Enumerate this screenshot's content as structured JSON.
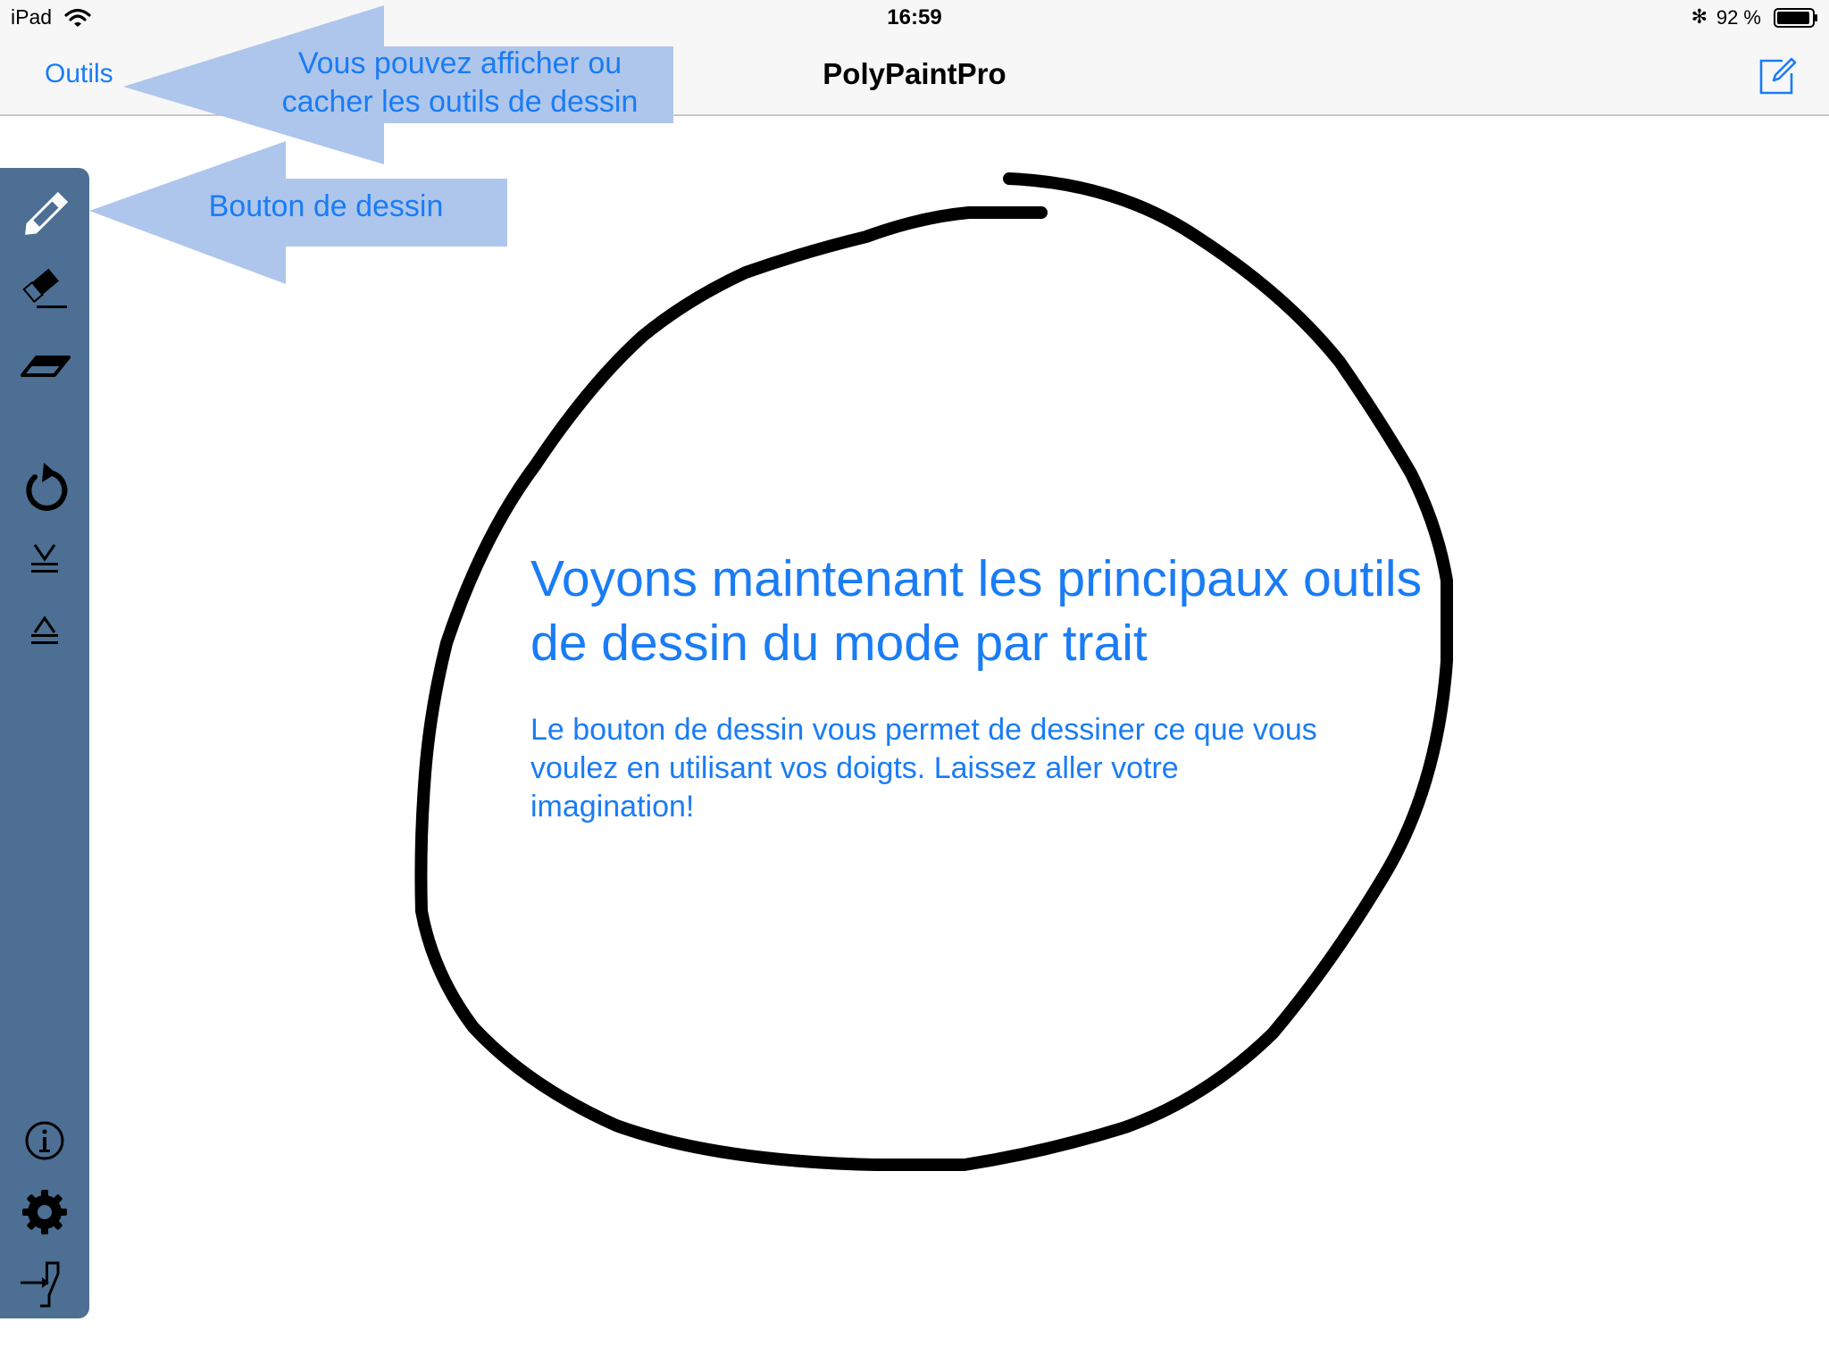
{
  "status_bar": {
    "device": "iPad",
    "time": "16:59",
    "battery_percent": "92 %",
    "bluetooth_glyph": "✻",
    "icons": [
      "wifi-icon",
      "bluetooth-icon",
      "battery-icon"
    ]
  },
  "nav": {
    "left_button": "Outils",
    "title": "PolyPaintPro",
    "right_icon": "compose-icon"
  },
  "callouts": {
    "tools_line1": "Vous pouvez afficher ou",
    "tools_line2": "cacher les outils de dessin",
    "draw_button": "Bouton de dessin",
    "color": "#aec6ec"
  },
  "toolbar": {
    "background": "#4c6f93",
    "tools": [
      "pencil-icon",
      "stroke-eraser-icon",
      "eraser-icon",
      "undo-icon",
      "send-backward-icon",
      "bring-forward-icon",
      "info-icon",
      "settings-icon",
      "exit-icon"
    ]
  },
  "tutorial": {
    "heading": "Voyons maintenant les principaux outils de dessin du mode par trait",
    "body": "Le bouton de dessin vous permet de dessiner ce que vous voulez en utilisant vos doigts. Laissez aller votre imagination!",
    "color": "#1a7cf5"
  },
  "drawing": {
    "stroke_color": "#000000"
  }
}
